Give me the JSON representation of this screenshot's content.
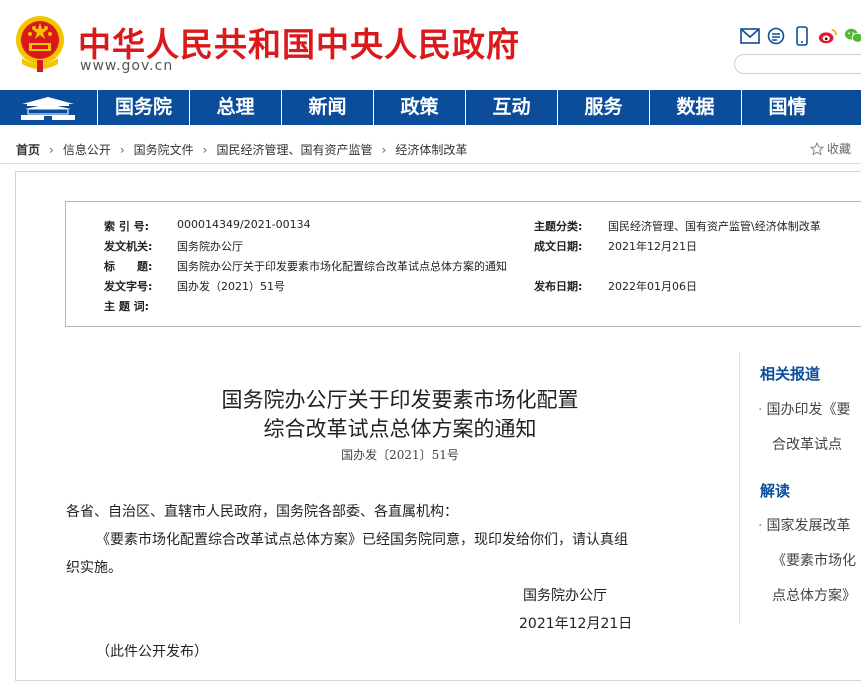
{
  "header": {
    "site_title": "中华人民共和国中央人民政府",
    "site_url": "www.gov.cn"
  },
  "nav": {
    "items": [
      "国务院",
      "总理",
      "新闻",
      "政策",
      "互动",
      "服务",
      "数据",
      "国情"
    ]
  },
  "breadcrumb": [
    "首页",
    "信息公开",
    "国务院文件",
    "国民经济管理、国有资产监管",
    "经济体制改革"
  ],
  "favorite_label": "收藏",
  "meta": {
    "index_label": "索 引 号:",
    "index_value": "000014349/2021-00134",
    "category_label": "主题分类:",
    "category_value": "国民经济管理、国有资产监管\\经济体制改革",
    "issuer_label": "发文机关:",
    "issuer_value": "国务院办公厅",
    "date_written_label": "成文日期:",
    "date_written_value": "2021年12月21日",
    "title_label": "标　　题:",
    "title_value": "国务院办公厅关于印发要素市场化配置综合改革试点总体方案的通知",
    "doc_no_label": "发文字号:",
    "doc_no_value": "国办发（2021）51号",
    "pub_date_label": "发布日期:",
    "pub_date_value": "2022年01月06日",
    "subject_label": "主 题 词:"
  },
  "article": {
    "title_line1": "国务院办公厅关于印发要素市场化配置",
    "title_line2": "综合改革试点总体方案的通知",
    "doc_number": "国办发〔2021〕51号",
    "salutation": "各省、自治区、直辖市人民政府，国务院各部委、各直属机构：",
    "para1_line1": "《要素市场化配置综合改革试点总体方案》已经国务院同意，现印发给你们，请认真组",
    "para1_line2": "织实施。",
    "signer": "国务院办公厅",
    "sign_date": "2021年12月21日",
    "note": "（此件公开发布）"
  },
  "sidebar": {
    "related_heading": "相关报道",
    "related_line1": "国办印发《要",
    "related_line2": "合改革试点",
    "interpret_heading": "解读",
    "interpret_line1": "国家发展改革",
    "interpret_line2": "《要素市场化",
    "interpret_line3": "点总体方案》"
  },
  "colors": {
    "brand_red": "#d9191b",
    "nav_blue": "#0b4d9b"
  }
}
